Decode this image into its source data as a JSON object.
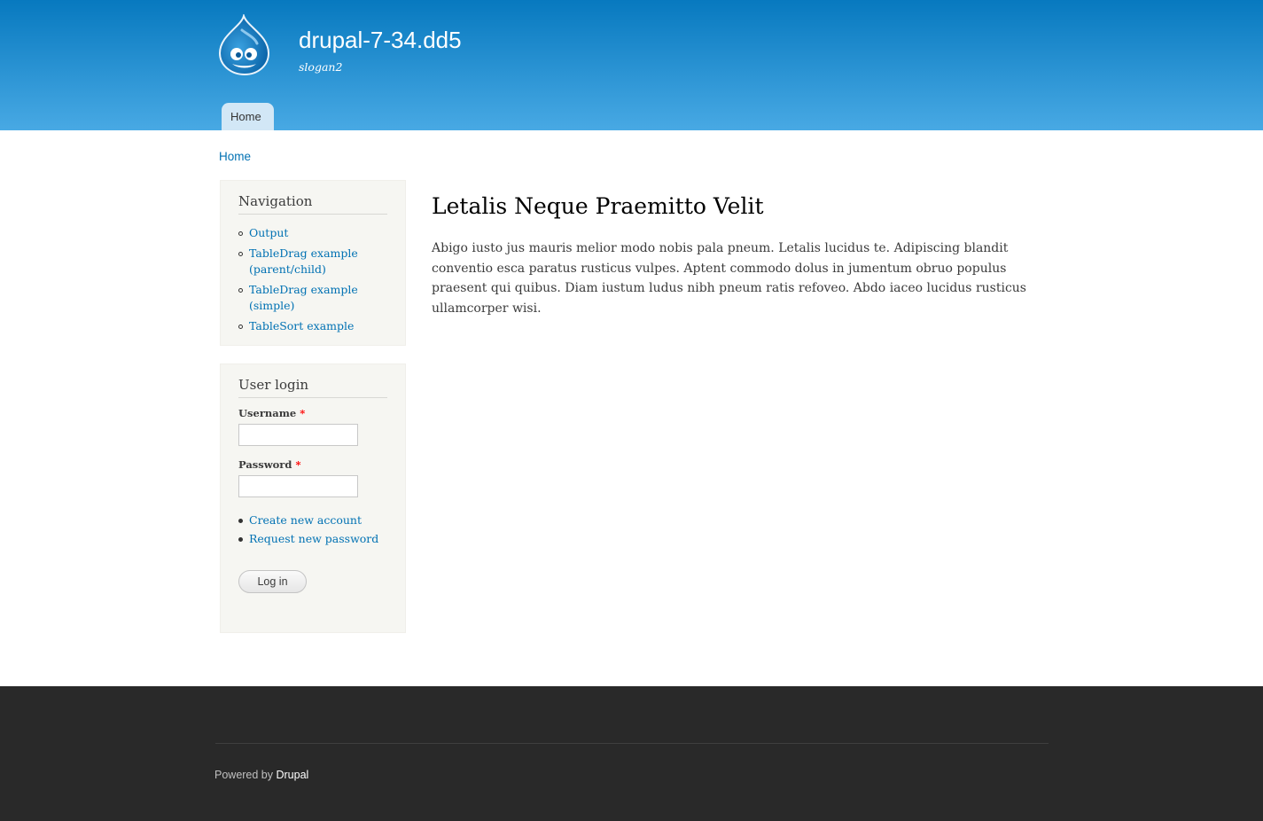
{
  "header": {
    "site_name": "drupal-7-34.dd5",
    "slogan": "slogan2",
    "main_menu": [
      {
        "label": "Home"
      }
    ]
  },
  "breadcrumb": {
    "home": "Home"
  },
  "navigation": {
    "title": "Navigation",
    "items": [
      {
        "label": "Output"
      },
      {
        "label": "TableDrag example (parent/child)"
      },
      {
        "label": "TableDrag example (simple)"
      },
      {
        "label": "TableSort example"
      }
    ]
  },
  "user_login": {
    "title": "User login",
    "username_label": "Username",
    "password_label": "Password",
    "required_marker": "*",
    "username_value": "",
    "password_value": "",
    "links": [
      {
        "label": "Create new account"
      },
      {
        "label": "Request new password"
      }
    ],
    "submit_label": "Log in"
  },
  "content": {
    "title": "Letalis Neque Praemitto Velit",
    "body": "Abigo iusto jus mauris melior modo nobis pala pneum. Letalis lucidus te. Adipiscing blandit conventio esca paratus rusticus vulpes. Aptent commodo dolus in jumentum obruo populus praesent qui quibus. Diam iustum ludus nibh pneum ratis refoveo. Abdo iaceo lucidus rusticus ullamcorper wisi."
  },
  "footer": {
    "powered_prefix": "Powered by ",
    "powered_link": "Drupal"
  },
  "colors": {
    "header_top": "#0779bf",
    "header_bottom": "#48a9e4",
    "link": "#0071b3",
    "footer_bg": "#292929",
    "sidebar_bg": "#f6f6f2"
  }
}
